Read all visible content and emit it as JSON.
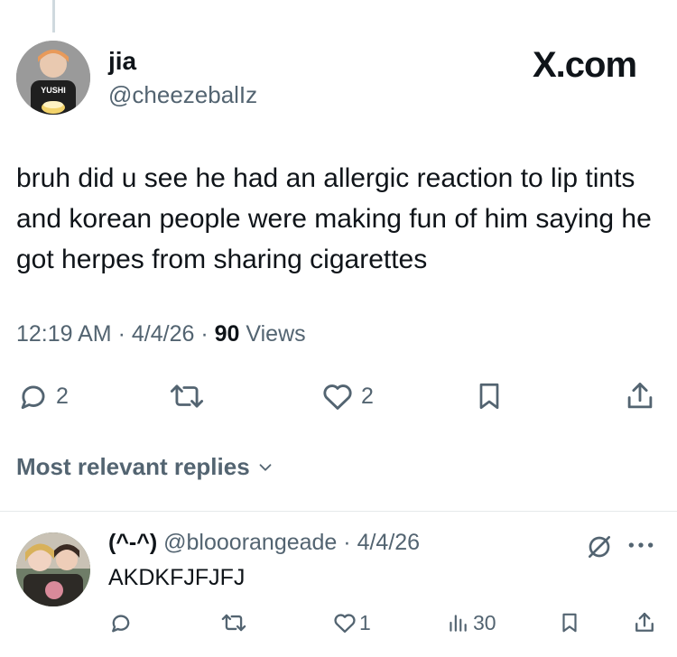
{
  "tweet": {
    "author_name": "jia",
    "author_handle": "@cheezebalIz",
    "avatar_shirt_text": "YUSHI",
    "brand": "X.com",
    "text": "bruh did u see he had an allergic reaction to lip tints and korean people were making fun of him saying he got herpes from sharing cigarettes",
    "time": "12:19 AM",
    "date": "4/4/26",
    "views_count": "90",
    "views_label": "Views",
    "replies_count": "2",
    "likes_count": "2"
  },
  "replies_section": {
    "label": "Most relevant replies"
  },
  "reply": {
    "name": "(^-^)",
    "handle": "@blooorangeade",
    "date": "4/4/26",
    "text": "AKDKFJFJFJ",
    "likes_count": "1",
    "views_count": "30"
  },
  "colors": {
    "text": "#0f1419",
    "muted": "#536471",
    "divider": "#e6e9eb"
  },
  "icons": [
    "reply-icon",
    "retweet-icon",
    "like-icon",
    "bookmark-icon",
    "share-icon",
    "chevron-down-icon",
    "grok-icon",
    "more-icon",
    "views-icon"
  ]
}
